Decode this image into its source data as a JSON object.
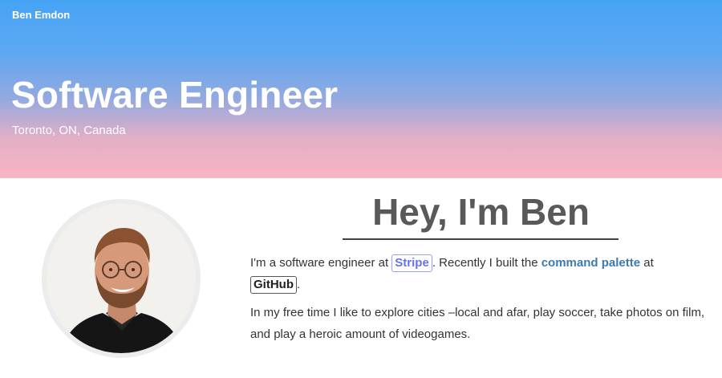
{
  "header": {
    "site_name": "Ben Emdon",
    "title": "Software Engineer",
    "location": "Toronto, ON, Canada"
  },
  "intro": {
    "greeting": "Hey, I'm Ben",
    "p1_before_stripe": "I'm a software engineer at ",
    "stripe_label": "Stripe",
    "p1_between": ". Recently I built the ",
    "command_palette_label": "command palette",
    "p1_after_link": " at",
    "github_label": "GitHub",
    "p1_end": ".",
    "p2": "In my free time I like to explore cities –local and afar, play soccer, take photos on film, and play a heroic amount of videogames."
  },
  "colors": {
    "hero_top": "#46a4f5",
    "hero_bottom": "#f9b4c4",
    "stripe": "#6772e5",
    "link": "#3c7bb0"
  }
}
